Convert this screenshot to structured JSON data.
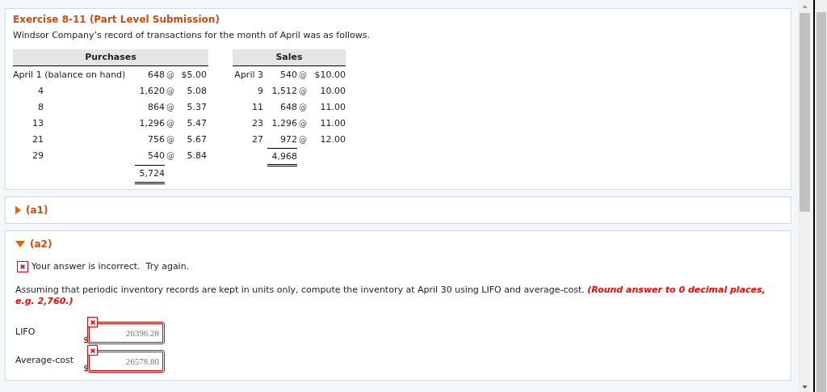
{
  "exercise": {
    "title": "Exercise 8-11 (Part Level Submission)",
    "intro": "Windsor Company’s record of transactions for the month of April was as follows."
  },
  "table": {
    "purchases_header": "Purchases",
    "sales_header": "Sales",
    "purchases": [
      {
        "date": "April 1 (balance on hand)",
        "qty": "648",
        "at": "@",
        "price": "$5.00"
      },
      {
        "date": "4",
        "qty": "1,620",
        "at": "@",
        "price": "5.08"
      },
      {
        "date": "8",
        "qty": "864",
        "at": "@",
        "price": "5.37"
      },
      {
        "date": "13",
        "qty": "1,296",
        "at": "@",
        "price": "5.47"
      },
      {
        "date": "21",
        "qty": "756",
        "at": "@",
        "price": "5.67"
      },
      {
        "date": "29",
        "qty": "540",
        "at": "@",
        "price": "5.84"
      }
    ],
    "purchases_total": "5,724",
    "sales": [
      {
        "date": "April 3",
        "qty": "540",
        "at": "@",
        "price": "$10.00"
      },
      {
        "date": "9",
        "qty": "1,512",
        "at": "@",
        "price": "10.00"
      },
      {
        "date": "11",
        "qty": "648",
        "at": "@",
        "price": "11.00"
      },
      {
        "date": "23",
        "qty": "1,296",
        "at": "@",
        "price": "11.00"
      },
      {
        "date": "27",
        "qty": "972",
        "at": "@",
        "price": "12.00"
      }
    ],
    "sales_total": "4,968"
  },
  "parts": [
    {
      "label": "(a1)",
      "expanded": false
    },
    {
      "label": "(a2)",
      "expanded": true,
      "feedback": "Your answer is incorrect.  Try again.",
      "question": "Assuming that periodic inventory records are kept in units only, compute the inventory at April 30 using LIFO and average-cost.",
      "hint": "(Round answer to 0 decimal places, e.g. 2,760.)",
      "answers": [
        {
          "label": "LIFO",
          "currency": "$",
          "value": "26396.28",
          "incorrect": true
        },
        {
          "label": "Average-cost",
          "currency": "$",
          "value": "26578.80",
          "incorrect": true
        }
      ]
    }
  ]
}
